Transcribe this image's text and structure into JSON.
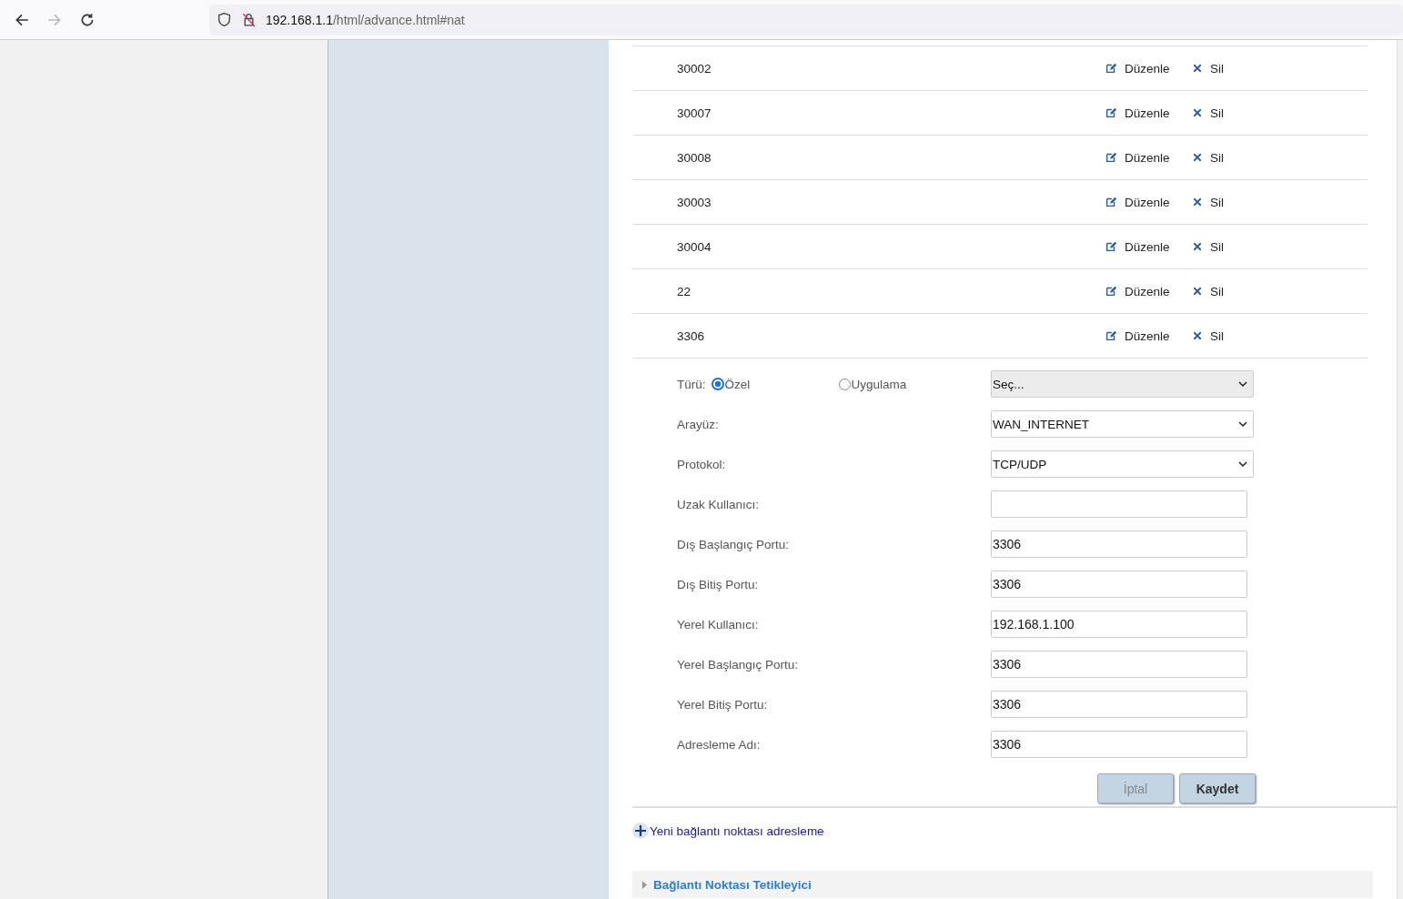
{
  "browser": {
    "url_host": "192.168.1.1",
    "url_path": "/html/advance.html#nat"
  },
  "rules": [
    {
      "name": "30002",
      "edit": "Düzenle",
      "delete": "Sil"
    },
    {
      "name": "30007",
      "edit": "Düzenle",
      "delete": "Sil"
    },
    {
      "name": "30008",
      "edit": "Düzenle",
      "delete": "Sil"
    },
    {
      "name": "30003",
      "edit": "Düzenle",
      "delete": "Sil"
    },
    {
      "name": "30004",
      "edit": "Düzenle",
      "delete": "Sil"
    },
    {
      "name": "22",
      "edit": "Düzenle",
      "delete": "Sil"
    },
    {
      "name": "3306",
      "edit": "Düzenle",
      "delete": "Sil"
    }
  ],
  "form": [
    {
      "kind": "type",
      "label": "Türü:",
      "options": [
        {
          "label": "Özel",
          "selected": true
        },
        {
          "label": "Uygulama",
          "selected": false
        }
      ],
      "select": "Seç...",
      "disabled": true
    },
    {
      "kind": "select",
      "label": "Arayüz:",
      "value": "WAN_INTERNET"
    },
    {
      "kind": "select",
      "label": "Protokol:",
      "value": "TCP/UDP"
    },
    {
      "kind": "input",
      "label": "Uzak Kullanıcı:"
    },
    {
      "kind": "input",
      "label": "Dış Başlangıç Portu:",
      "value": "3306"
    },
    {
      "kind": "input",
      "label": "Dış Bitiş Portu:",
      "value": "3306"
    },
    {
      "kind": "input",
      "label": "Yerel Kullanıcı:",
      "value": "192.168.1.100"
    },
    {
      "kind": "input",
      "label": "Yerel Başlangıç Portu:",
      "value": "3306"
    },
    {
      "kind": "input",
      "label": "Yerel Bitiş Portu:",
      "value": "3306"
    },
    {
      "kind": "input",
      "label": "Adresleme Adı:",
      "value": "3306"
    }
  ],
  "buttons": [
    {
      "label": "İptal",
      "kind": "cancel"
    },
    {
      "label": "Kaydet",
      "kind": "save"
    }
  ],
  "add_link": "Yeni bağlantı noktası adresleme",
  "section": {
    "title": "Bağlantı Noktası Tetikleyici",
    "expanded": false
  }
}
